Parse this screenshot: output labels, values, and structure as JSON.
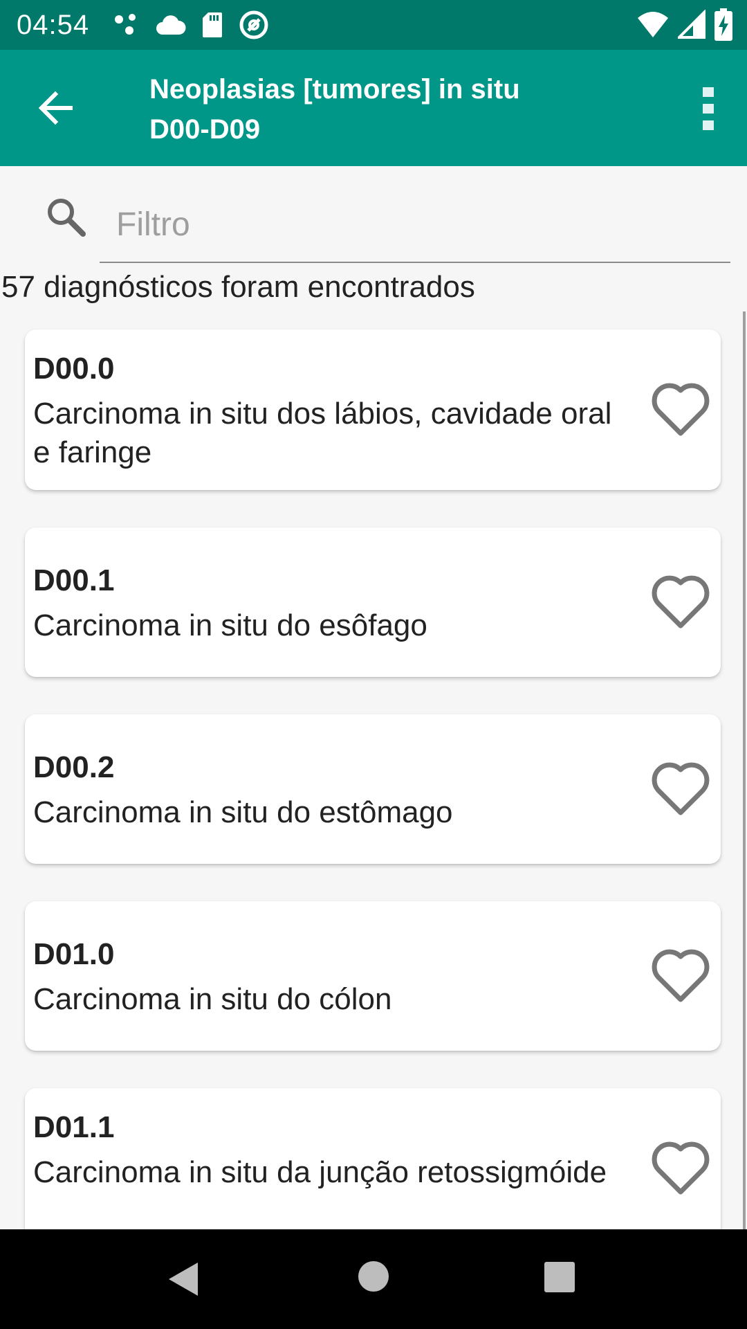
{
  "status_bar": {
    "time": "04:54",
    "left_icons": [
      "dots-icon",
      "cloud-icon",
      "sd-card-icon",
      "sync-icon"
    ],
    "right_icons": [
      "wifi-icon",
      "signal-icon",
      "battery-charging-icon"
    ]
  },
  "app_bar": {
    "title_line1": "Neoplasias [tumores] in situ",
    "title_line2": "D00-D09",
    "back_icon": "arrow-back-icon",
    "menu_icon": "more-vert-icon",
    "color": "#009688",
    "status_color": "#00796b"
  },
  "search": {
    "placeholder": "Filtro",
    "value": ""
  },
  "results": {
    "count_text": "57 diagnósticos foram encontrados"
  },
  "diagnoses": [
    {
      "code": "D00.0",
      "description": "Carcinoma in situ dos lábios, cavidade oral e faringe",
      "favorite": false
    },
    {
      "code": "D00.1",
      "description": "Carcinoma in situ do esôfago",
      "favorite": false
    },
    {
      "code": "D00.2",
      "description": "Carcinoma in situ do estômago",
      "favorite": false
    },
    {
      "code": "D01.0",
      "description": "Carcinoma in situ do cólon",
      "favorite": false
    },
    {
      "code": "D01.1",
      "description": "Carcinoma in situ da junção retossigmóide",
      "favorite": false
    }
  ],
  "nav_bar": {
    "buttons": [
      "back-triangle-icon",
      "home-circle-icon",
      "recents-square-icon"
    ]
  }
}
